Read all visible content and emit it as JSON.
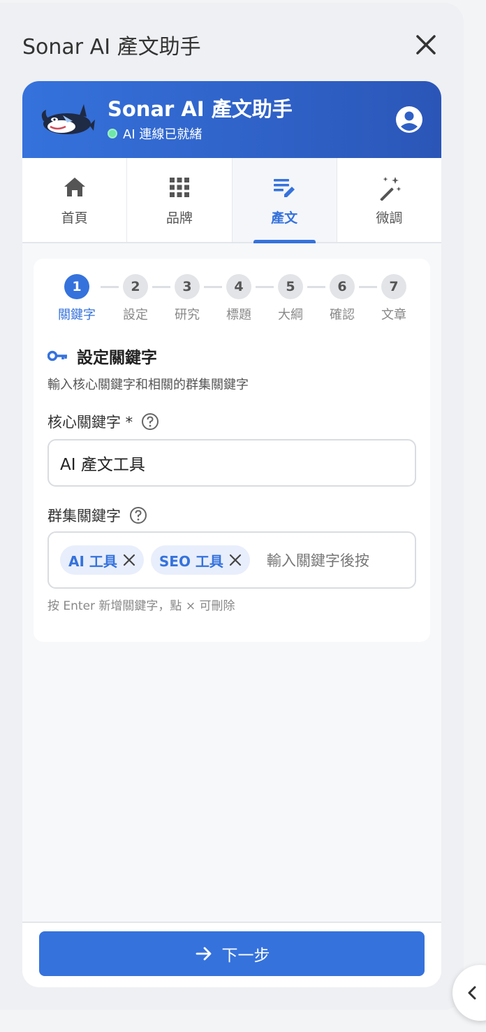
{
  "panel": {
    "title": "Sonar AI 產文助手"
  },
  "app": {
    "title": "Sonar AI 產文助手",
    "status": "AI 連線已就緒"
  },
  "tabs": [
    {
      "label": "首頁",
      "icon": "home-icon"
    },
    {
      "label": "品牌",
      "icon": "grid-icon"
    },
    {
      "label": "產文",
      "icon": "edit-list-icon",
      "active": true
    },
    {
      "label": "微調",
      "icon": "magic-wand-icon"
    }
  ],
  "steps": [
    {
      "num": "1",
      "label": "關鍵字",
      "active": true
    },
    {
      "num": "2",
      "label": "設定"
    },
    {
      "num": "3",
      "label": "研究"
    },
    {
      "num": "4",
      "label": "標題"
    },
    {
      "num": "5",
      "label": "大綱"
    },
    {
      "num": "6",
      "label": "確認"
    },
    {
      "num": "7",
      "label": "文章"
    }
  ],
  "section": {
    "title": "設定關鍵字",
    "desc": "輸入核心關鍵字和相關的群集關鍵字"
  },
  "core_keyword": {
    "label": "核心關鍵字 *",
    "value": "AI 產文工具"
  },
  "cluster_keywords": {
    "label": "群集關鍵字",
    "tags": [
      "AI 工具",
      "SEO 工具"
    ],
    "placeholder": "輸入關鍵字後按",
    "hint": "按 Enter 新增關鍵字，點 × 可刪除"
  },
  "footer": {
    "next_label": "下一步"
  },
  "colors": {
    "primary": "#3572dc",
    "status_green": "#6ee7a8"
  }
}
